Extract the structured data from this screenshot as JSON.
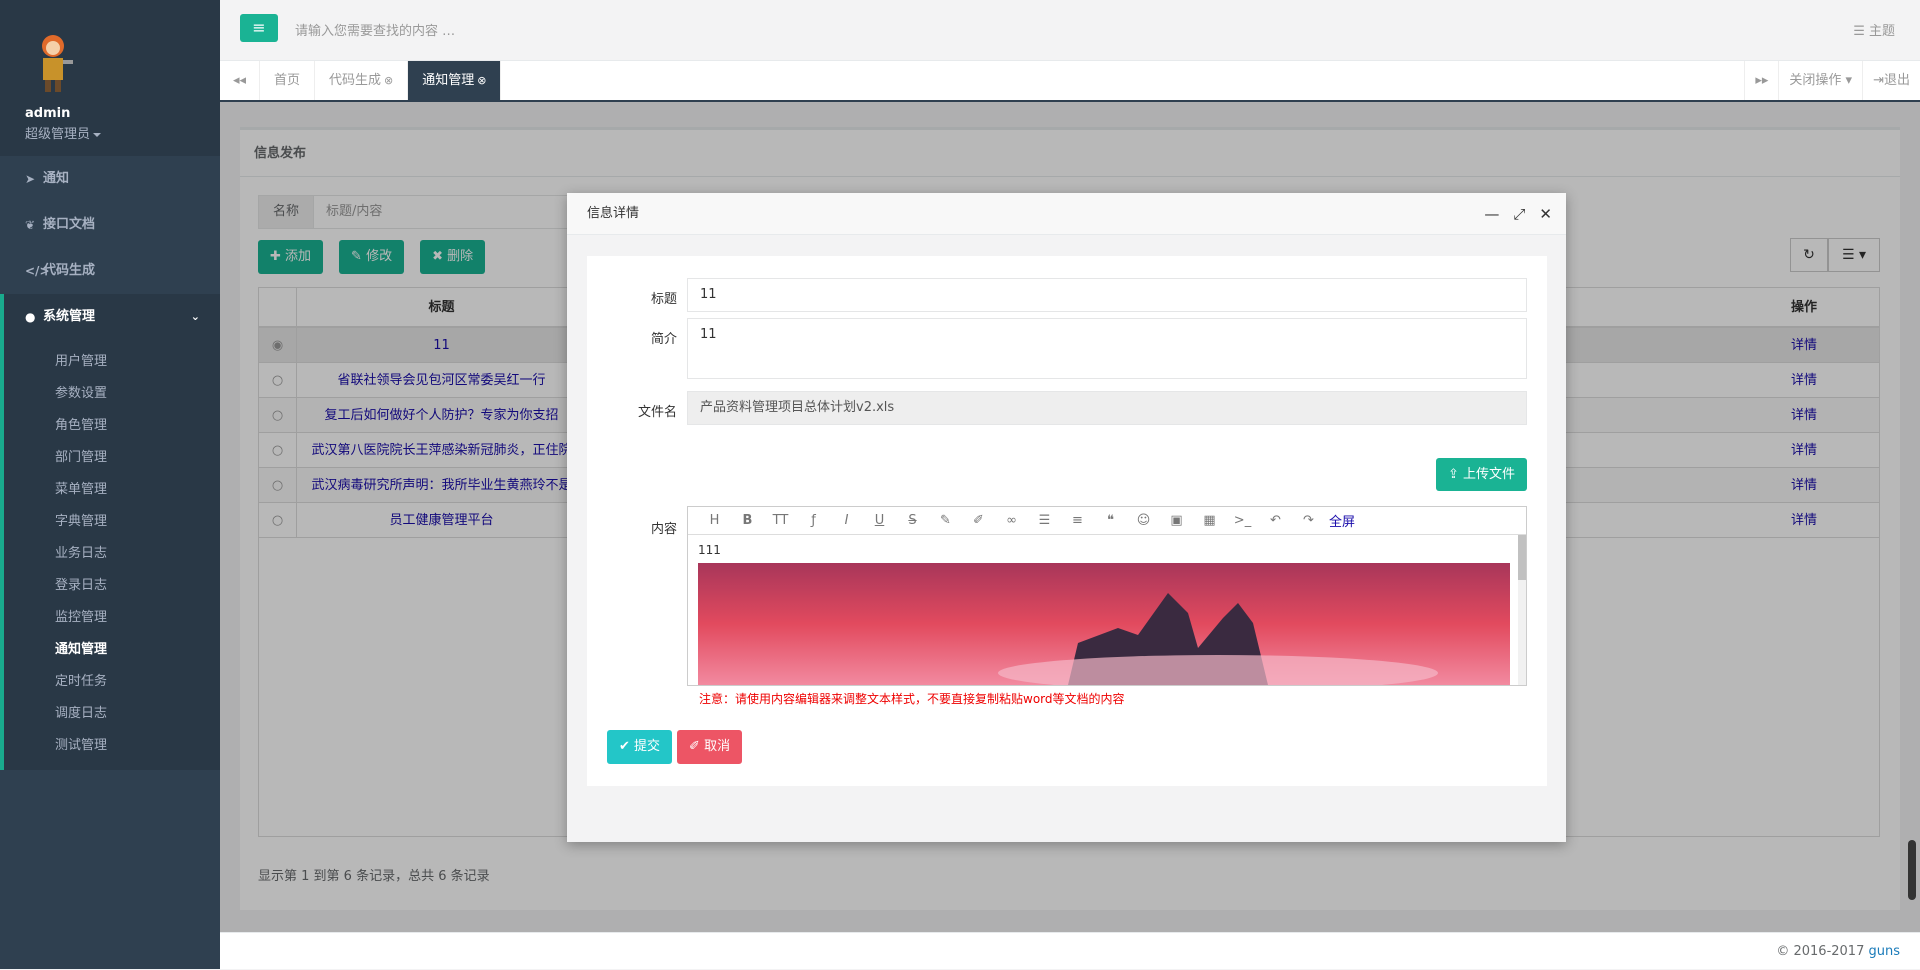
{
  "user": {
    "name": "admin",
    "role": "超级管理员"
  },
  "nav": {
    "items": [
      {
        "label": "通知",
        "icon": "send-icon"
      },
      {
        "label": "接口文档",
        "icon": "leaf-icon"
      },
      {
        "label": "代码生成",
        "icon": "code-icon"
      },
      {
        "label": "系统管理",
        "icon": "user-icon"
      }
    ],
    "submenu": [
      "用户管理",
      "参数设置",
      "角色管理",
      "部门管理",
      "菜单管理",
      "字典管理",
      "业务日志",
      "登录日志",
      "监控管理",
      "通知管理",
      "定时任务",
      "调度日志",
      "测试管理"
    ]
  },
  "topbar": {
    "search_placeholder": "请输入您需要查找的内容 …",
    "theme_label": "主题"
  },
  "tabs": {
    "items": [
      "首页",
      "代码生成",
      "通知管理"
    ],
    "close_ops": "关闭操作",
    "logout": "退出"
  },
  "panel": {
    "title": "信息发布",
    "filter_label": "名称",
    "filter_placeholder": "标题/内容",
    "add": "添加",
    "edit": "修改",
    "delete": "删除",
    "col_title": "标题",
    "col_op": "操作",
    "rows": [
      {
        "title": "11",
        "op": "详情"
      },
      {
        "title": "省联社领导会见包河区常委吴红一行",
        "op": "详情"
      },
      {
        "title": "复工后如何做好个人防护？专家为你支招",
        "op": "详情"
      },
      {
        "title": "武汉第八医院院长王萍感染新冠肺炎，正住院",
        "op": "详情"
      },
      {
        "title": "武汉病毒研究所声明：我所毕业生黄燕玲不是",
        "op": "详情"
      },
      {
        "title": "员工健康管理平台",
        "op": "详情"
      }
    ],
    "page_info": "显示第 1 到第 6 条记录，总共 6 条记录"
  },
  "footer": {
    "copyright": "© 2016-2017 ",
    "link": "guns"
  },
  "modal": {
    "title": "信息详情",
    "title_label": "标题",
    "title_value": "11",
    "summary_label": "简介",
    "summary_value": "11",
    "file_label": "文件名",
    "file_value": "产品资料管理项目总体计划v2.xls",
    "upload": "上传文件",
    "content_label": "内容",
    "content_text": "111",
    "fullscreen": "全屏",
    "note": "注意：请使用内容编辑器来调整文本样式，不要直接复制粘贴word等文档的内容",
    "submit": "提交",
    "cancel": "取消"
  },
  "colors": {
    "primary": "#1ab394",
    "sidebar": "#2f4050",
    "danger": "#ed5565",
    "info": "#23c6c8"
  }
}
